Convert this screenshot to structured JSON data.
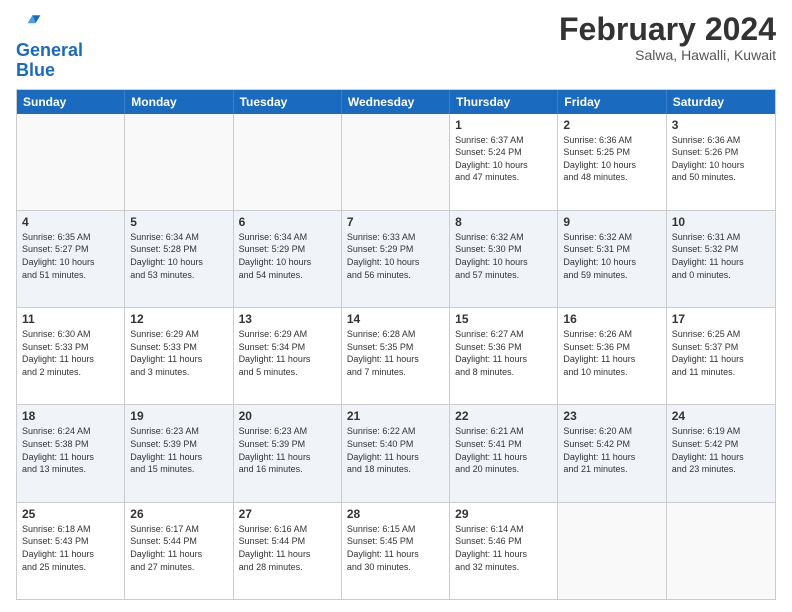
{
  "header": {
    "logo_line1": "General",
    "logo_line2": "Blue",
    "month": "February 2024",
    "location": "Salwa, Hawalli, Kuwait"
  },
  "weekdays": [
    "Sunday",
    "Monday",
    "Tuesday",
    "Wednesday",
    "Thursday",
    "Friday",
    "Saturday"
  ],
  "rows": [
    [
      {
        "day": "",
        "info": ""
      },
      {
        "day": "",
        "info": ""
      },
      {
        "day": "",
        "info": ""
      },
      {
        "day": "",
        "info": ""
      },
      {
        "day": "1",
        "info": "Sunrise: 6:37 AM\nSunset: 5:24 PM\nDaylight: 10 hours\nand 47 minutes."
      },
      {
        "day": "2",
        "info": "Sunrise: 6:36 AM\nSunset: 5:25 PM\nDaylight: 10 hours\nand 48 minutes."
      },
      {
        "day": "3",
        "info": "Sunrise: 6:36 AM\nSunset: 5:26 PM\nDaylight: 10 hours\nand 50 minutes."
      }
    ],
    [
      {
        "day": "4",
        "info": "Sunrise: 6:35 AM\nSunset: 5:27 PM\nDaylight: 10 hours\nand 51 minutes."
      },
      {
        "day": "5",
        "info": "Sunrise: 6:34 AM\nSunset: 5:28 PM\nDaylight: 10 hours\nand 53 minutes."
      },
      {
        "day": "6",
        "info": "Sunrise: 6:34 AM\nSunset: 5:29 PM\nDaylight: 10 hours\nand 54 minutes."
      },
      {
        "day": "7",
        "info": "Sunrise: 6:33 AM\nSunset: 5:29 PM\nDaylight: 10 hours\nand 56 minutes."
      },
      {
        "day": "8",
        "info": "Sunrise: 6:32 AM\nSunset: 5:30 PM\nDaylight: 10 hours\nand 57 minutes."
      },
      {
        "day": "9",
        "info": "Sunrise: 6:32 AM\nSunset: 5:31 PM\nDaylight: 10 hours\nand 59 minutes."
      },
      {
        "day": "10",
        "info": "Sunrise: 6:31 AM\nSunset: 5:32 PM\nDaylight: 11 hours\nand 0 minutes."
      }
    ],
    [
      {
        "day": "11",
        "info": "Sunrise: 6:30 AM\nSunset: 5:33 PM\nDaylight: 11 hours\nand 2 minutes."
      },
      {
        "day": "12",
        "info": "Sunrise: 6:29 AM\nSunset: 5:33 PM\nDaylight: 11 hours\nand 3 minutes."
      },
      {
        "day": "13",
        "info": "Sunrise: 6:29 AM\nSunset: 5:34 PM\nDaylight: 11 hours\nand 5 minutes."
      },
      {
        "day": "14",
        "info": "Sunrise: 6:28 AM\nSunset: 5:35 PM\nDaylight: 11 hours\nand 7 minutes."
      },
      {
        "day": "15",
        "info": "Sunrise: 6:27 AM\nSunset: 5:36 PM\nDaylight: 11 hours\nand 8 minutes."
      },
      {
        "day": "16",
        "info": "Sunrise: 6:26 AM\nSunset: 5:36 PM\nDaylight: 11 hours\nand 10 minutes."
      },
      {
        "day": "17",
        "info": "Sunrise: 6:25 AM\nSunset: 5:37 PM\nDaylight: 11 hours\nand 11 minutes."
      }
    ],
    [
      {
        "day": "18",
        "info": "Sunrise: 6:24 AM\nSunset: 5:38 PM\nDaylight: 11 hours\nand 13 minutes."
      },
      {
        "day": "19",
        "info": "Sunrise: 6:23 AM\nSunset: 5:39 PM\nDaylight: 11 hours\nand 15 minutes."
      },
      {
        "day": "20",
        "info": "Sunrise: 6:23 AM\nSunset: 5:39 PM\nDaylight: 11 hours\nand 16 minutes."
      },
      {
        "day": "21",
        "info": "Sunrise: 6:22 AM\nSunset: 5:40 PM\nDaylight: 11 hours\nand 18 minutes."
      },
      {
        "day": "22",
        "info": "Sunrise: 6:21 AM\nSunset: 5:41 PM\nDaylight: 11 hours\nand 20 minutes."
      },
      {
        "day": "23",
        "info": "Sunrise: 6:20 AM\nSunset: 5:42 PM\nDaylight: 11 hours\nand 21 minutes."
      },
      {
        "day": "24",
        "info": "Sunrise: 6:19 AM\nSunset: 5:42 PM\nDaylight: 11 hours\nand 23 minutes."
      }
    ],
    [
      {
        "day": "25",
        "info": "Sunrise: 6:18 AM\nSunset: 5:43 PM\nDaylight: 11 hours\nand 25 minutes."
      },
      {
        "day": "26",
        "info": "Sunrise: 6:17 AM\nSunset: 5:44 PM\nDaylight: 11 hours\nand 27 minutes."
      },
      {
        "day": "27",
        "info": "Sunrise: 6:16 AM\nSunset: 5:44 PM\nDaylight: 11 hours\nand 28 minutes."
      },
      {
        "day": "28",
        "info": "Sunrise: 6:15 AM\nSunset: 5:45 PM\nDaylight: 11 hours\nand 30 minutes."
      },
      {
        "day": "29",
        "info": "Sunrise: 6:14 AM\nSunset: 5:46 PM\nDaylight: 11 hours\nand 32 minutes."
      },
      {
        "day": "",
        "info": ""
      },
      {
        "day": "",
        "info": ""
      }
    ]
  ]
}
